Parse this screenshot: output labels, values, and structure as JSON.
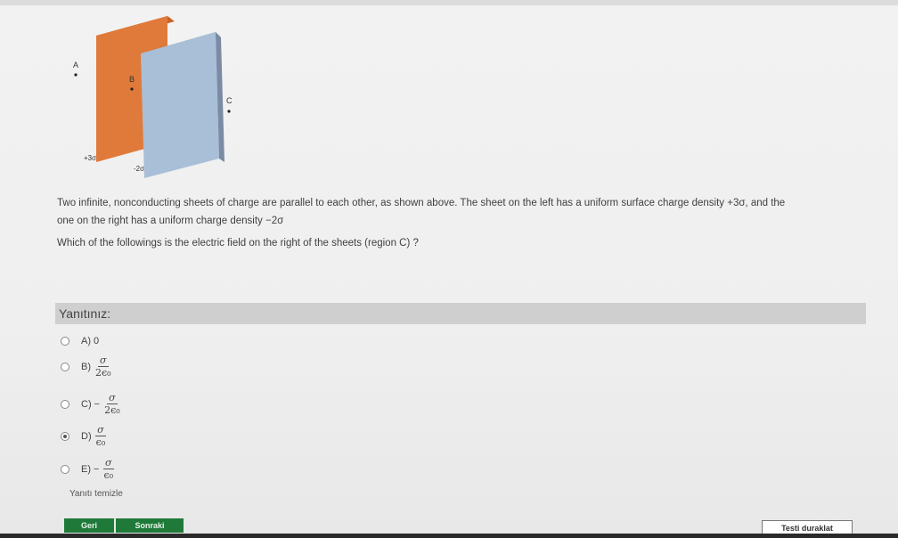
{
  "figure": {
    "point_a": "A",
    "point_b": "B",
    "point_c": "C",
    "left_charge": "+3σ",
    "right_charge": "-2σ",
    "colors": {
      "left_sheet": "#e07a3a",
      "right_sheet": "#a9bfd8"
    }
  },
  "question": {
    "line1": "Two infinite, nonconducting sheets of charge are parallel to each other, as shown above. The sheet on the left has a uniform surface charge density +3σ, and the",
    "line2": "one on the right has a uniform charge density −2σ",
    "which": "Which of the followings is the electric field on the right of the sheets (region C) ?"
  },
  "answer_header": "Yanıtınız:",
  "options": [
    {
      "label": "A) 0"
    },
    {
      "label": "B)",
      "num": "σ",
      "den": "2ϵ₀"
    },
    {
      "label": "C) −",
      "num": "σ",
      "den": "2ϵ₀"
    },
    {
      "label": "D)",
      "num": "σ",
      "den": "ϵ₀"
    },
    {
      "label": "E) −",
      "num": "σ",
      "den": "ϵ₀"
    }
  ],
  "clear_answer": "Yanıtı temizle",
  "buttons": {
    "back": "Geri",
    "next": "Sonraki",
    "pause": "Testi duraklat"
  }
}
